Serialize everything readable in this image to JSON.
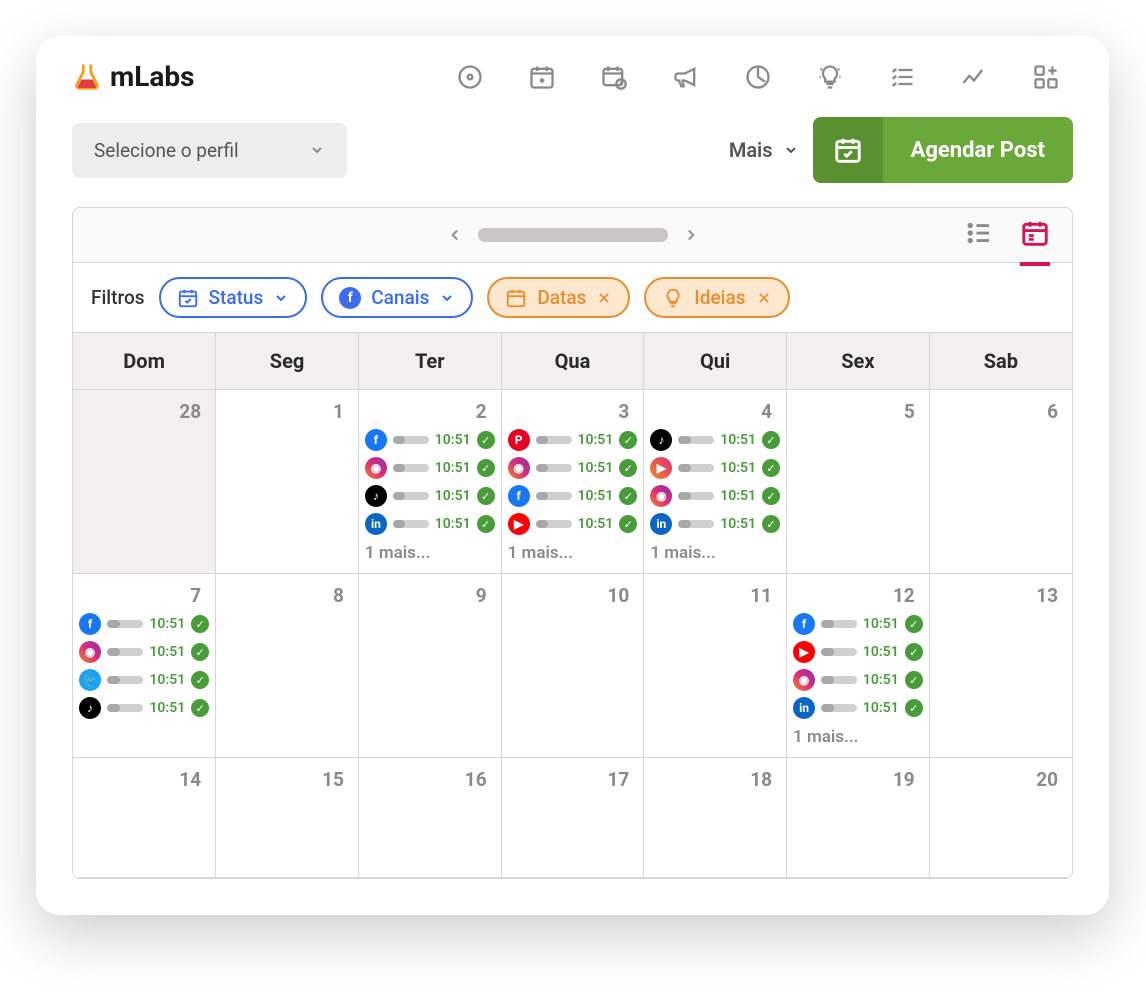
{
  "logo": "mLabs",
  "profile_select": {
    "label": "Selecione o perfil"
  },
  "more": "Mais",
  "schedule_button": "Agendar Post",
  "filters": {
    "label": "Filtros",
    "status": "Status",
    "channels": "Canais",
    "dates": "Datas",
    "ideas": "Ideias"
  },
  "days": [
    "Dom",
    "Seg",
    "Ter",
    "Qua",
    "Qui",
    "Sex",
    "Sab"
  ],
  "more_text": "1 mais...",
  "time": "10:51",
  "weeks": [
    [
      {
        "num": "28",
        "prev": true,
        "events": []
      },
      {
        "num": "1",
        "events": []
      },
      {
        "num": "2",
        "events": [
          "fb",
          "ig",
          "tk",
          "li"
        ],
        "more": true
      },
      {
        "num": "3",
        "events": [
          "pt",
          "ig",
          "fb",
          "yt"
        ],
        "more": true
      },
      {
        "num": "4",
        "events": [
          "tk",
          "rl",
          "ig",
          "li"
        ],
        "more": true
      },
      {
        "num": "5",
        "events": []
      },
      {
        "num": "6",
        "events": []
      }
    ],
    [
      {
        "num": "7",
        "events": [
          "fb",
          "ig",
          "tw",
          "tk"
        ]
      },
      {
        "num": "8",
        "events": []
      },
      {
        "num": "9",
        "events": []
      },
      {
        "num": "10",
        "events": []
      },
      {
        "num": "11",
        "events": []
      },
      {
        "num": "12",
        "events": [
          "fb",
          "yt",
          "ig",
          "li"
        ],
        "more": true
      },
      {
        "num": "13",
        "events": []
      }
    ],
    [
      {
        "num": "14",
        "events": []
      },
      {
        "num": "15",
        "events": []
      },
      {
        "num": "16",
        "events": []
      },
      {
        "num": "17",
        "events": []
      },
      {
        "num": "18",
        "events": []
      },
      {
        "num": "19",
        "events": []
      },
      {
        "num": "20",
        "events": []
      }
    ]
  ]
}
